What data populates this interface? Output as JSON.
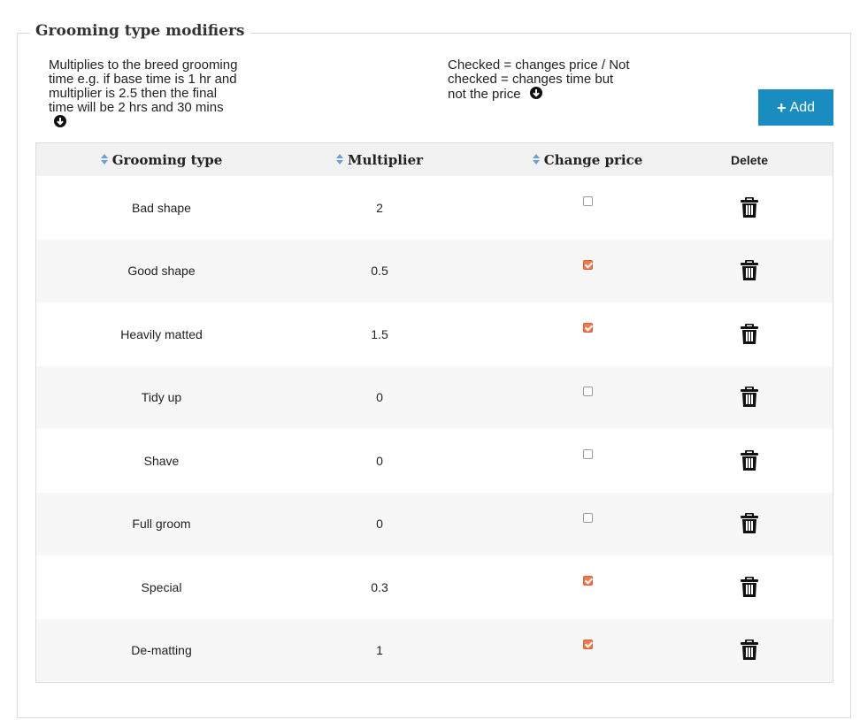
{
  "section": {
    "title": "Grooming type modifiers",
    "help_left": "Multiplies to the breed grooming time e.g. if base time is 1 hr and multiplier is 2.5 then the final time will be 2 hrs and 30 mins",
    "help_right": "Checked = changes price / Not checked = changes time but not the price",
    "add_label": "Add"
  },
  "table": {
    "headers": {
      "type": "Grooming type",
      "multiplier": "Multiplier",
      "change_price": "Change price",
      "delete": "Delete"
    },
    "rows": [
      {
        "type": "Bad shape",
        "multiplier": "2",
        "change_price": false
      },
      {
        "type": "Good shape",
        "multiplier": "0.5",
        "change_price": true
      },
      {
        "type": "Heavily matted",
        "multiplier": "1.5",
        "change_price": true
      },
      {
        "type": "Tidy up",
        "multiplier": "0",
        "change_price": false
      },
      {
        "type": "Shave",
        "multiplier": "0",
        "change_price": false
      },
      {
        "type": "Full groom",
        "multiplier": "0",
        "change_price": false
      },
      {
        "type": "Special",
        "multiplier": "0.3",
        "change_price": true
      },
      {
        "type": "De-matting",
        "multiplier": "1",
        "change_price": true
      }
    ]
  },
  "colors": {
    "accent": "#1a8dc0",
    "checkbox_checked": "#f07a4f",
    "row_alt": "#f7f7f7"
  },
  "icons": [
    "sort-icon",
    "arrow-down-circle-icon",
    "plus-icon",
    "trash-icon"
  ]
}
